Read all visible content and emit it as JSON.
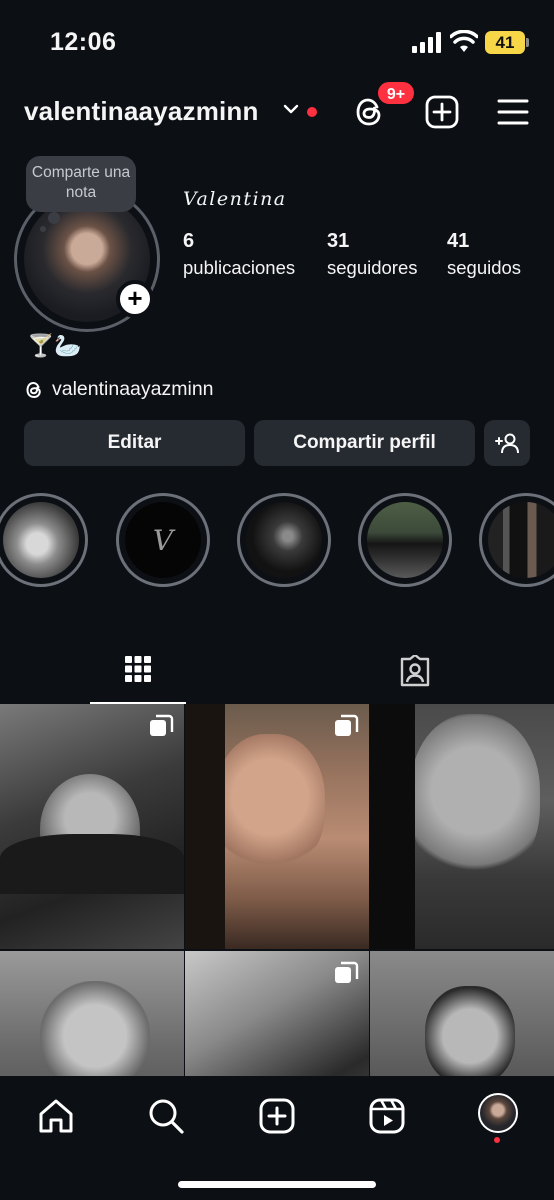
{
  "status_bar": {
    "time": "12:06",
    "battery": "41"
  },
  "header": {
    "username": "valentinaayazminn",
    "threads_badge": "9+"
  },
  "profile": {
    "note_placeholder": "Comparte una nota",
    "display_name": "Valentina",
    "stats": [
      {
        "value": "6",
        "label": "publicaciones"
      },
      {
        "value": "31",
        "label": "seguidores"
      },
      {
        "value": "41",
        "label": "seguidos"
      }
    ],
    "bio_emojis": "🍸🦢",
    "threads_handle": "valentinaayazminn"
  },
  "actions": {
    "edit_label": "Editar",
    "share_label": "Compartir perfil"
  },
  "highlights": [
    {
      "icon": "baby-photo"
    },
    {
      "icon": "letter-v",
      "letter": "V"
    },
    {
      "icon": "dark-photo"
    },
    {
      "icon": "car-photo"
    },
    {
      "icon": "screens-photo"
    }
  ],
  "tabs": [
    "grid-icon",
    "tagged-icon"
  ],
  "colors": {
    "background": "#0c0f14",
    "button": "#262a31",
    "accent_red": "#ff3040",
    "battery": "#f7d748"
  }
}
